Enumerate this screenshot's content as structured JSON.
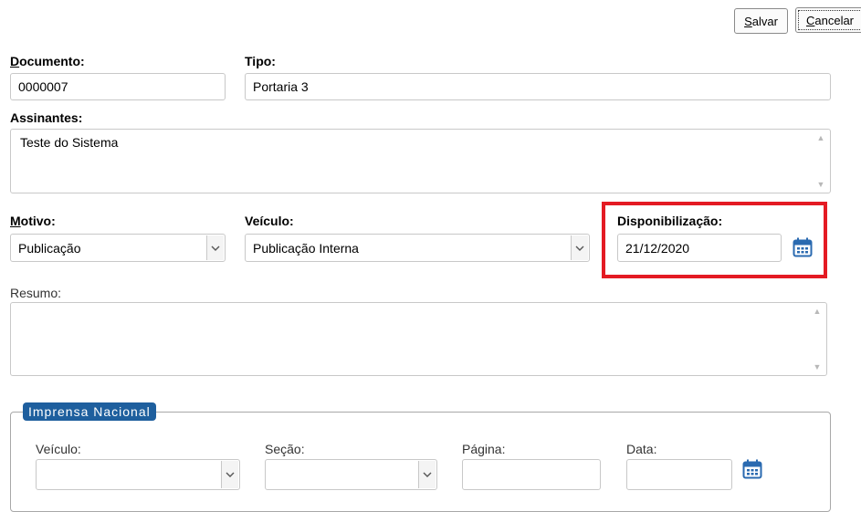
{
  "toolbar": {
    "save_label": "Salvar",
    "save_accel": "S",
    "save_rest": "alvar",
    "cancel_accel": "C",
    "cancel_rest": "ancelar"
  },
  "form": {
    "documento": {
      "label_accel": "D",
      "label_rest": "ocumento:",
      "value": "0000007"
    },
    "tipo": {
      "label": "Tipo:",
      "value": "Portaria 3"
    },
    "assinantes": {
      "label": "Assinantes:",
      "value": "Teste do Sistema"
    },
    "motivo": {
      "label_accel": "M",
      "label_rest": "otivo:",
      "value": "Publicação"
    },
    "veiculo": {
      "label": "Veículo:",
      "value": "Publicação Interna"
    },
    "disponibilizacao": {
      "label": "Disponibilização:",
      "value": "21/12/2020"
    },
    "resumo": {
      "label": "Resumo:",
      "value": ""
    }
  },
  "imprensa": {
    "legend": "Imprensa Nacional",
    "veiculo": {
      "label": "Veículo:",
      "value": ""
    },
    "secao": {
      "label": "Seção:",
      "value": ""
    },
    "pagina": {
      "label": "Página:",
      "value": ""
    },
    "data": {
      "label": "Data:",
      "value": ""
    }
  },
  "icons": {
    "calendar": "calendar-icon",
    "dropdown": "chevron-down-icon",
    "scroll_up": "scroll-up-icon",
    "scroll_down": "scroll-down-icon"
  },
  "colors": {
    "highlight": "#e41b23",
    "legend_bg": "#1e5f9e",
    "calendar": "#2a6ab0"
  }
}
